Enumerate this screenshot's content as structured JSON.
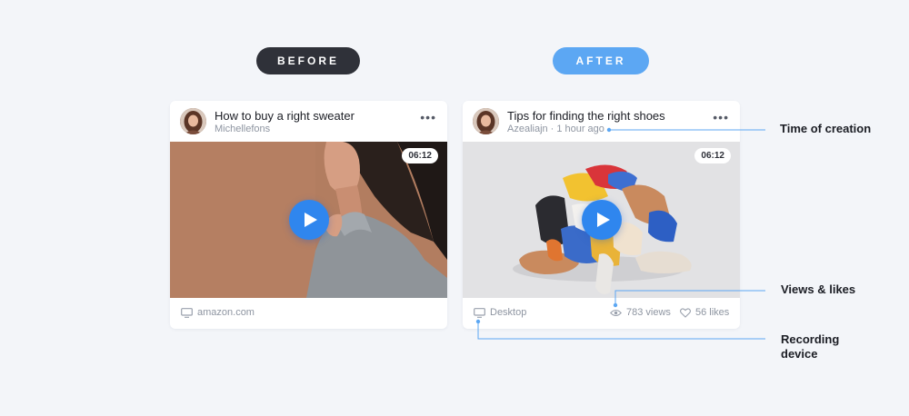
{
  "labels": {
    "before": "BEFORE",
    "after": "AFTER"
  },
  "before_card": {
    "title": "How to buy a right sweater",
    "author": "Michellefons",
    "duration": "06:12",
    "source": "amazon.com"
  },
  "after_card": {
    "title": "Tips for finding the right shoes",
    "author": "Azealiajn",
    "separator": "·",
    "time_ago": "1 hour ago",
    "duration": "06:12",
    "device": "Desktop",
    "views": "783 views",
    "likes": "56 likes"
  },
  "annotations": {
    "time": "Time of creation",
    "views_likes": "Views & likes",
    "recording_line1": "Recording",
    "recording_line2": "device"
  },
  "colors": {
    "background": "#f3f5f9",
    "before_pill": "#2f3139",
    "after_pill": "#5ca7f3",
    "play_button": "#2f86ee",
    "annotation_line": "#5ca7f3",
    "muted_text": "#8e95a1"
  },
  "icons": [
    "avatar",
    "more-dots-icon",
    "play-icon",
    "monitor-icon",
    "eye-icon",
    "heart-icon"
  ]
}
